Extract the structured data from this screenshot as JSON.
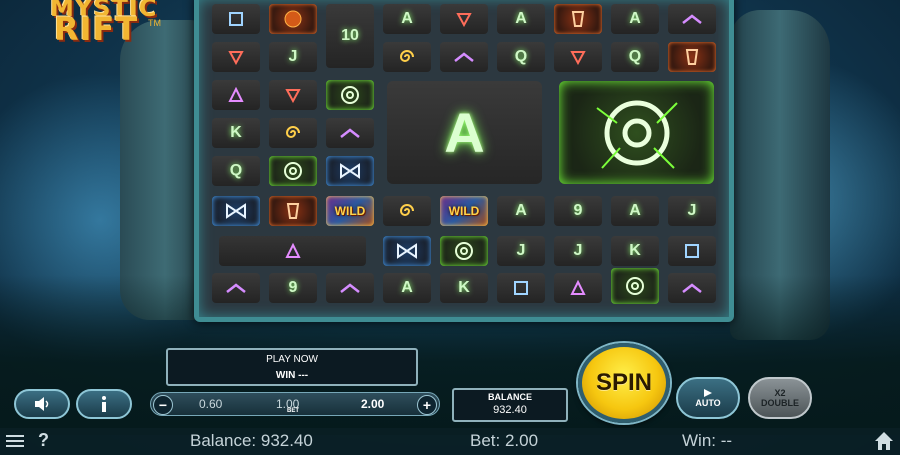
{
  "logo": {
    "line1": "MYSTIC",
    "line2": "RIFT",
    "tm": "TM"
  },
  "reels": {
    "labels": {
      "k": "K",
      "q": "Q",
      "j": "J",
      "a": "A",
      "nine": "9",
      "ten": "10",
      "wild": "WILD"
    },
    "big_symbol": "A"
  },
  "play_panel": {
    "status": "PLAY NOW",
    "win_label": "WIN ---"
  },
  "controls": {
    "sound_icon": "speaker-icon",
    "info_icon": "info-icon",
    "bet_minus": "−",
    "bet_plus": "+",
    "bet_values": [
      "0.60",
      "1.00",
      "2.00"
    ],
    "bet_selected": "2.00",
    "bet_label": "BET",
    "spin": "SPIN",
    "auto": "AUTO",
    "double_top": "X2",
    "double_bottom": "DOUBLE"
  },
  "balance_box": {
    "title": "BALANCE",
    "value": "932.40"
  },
  "status_bar": {
    "help": "?",
    "balance": "Balance: 932.40",
    "bet": "Bet: 2.00",
    "win": "Win: --"
  },
  "colors": {
    "spin": "#f6c710",
    "rune_glow": "#8cff70",
    "frame": "#3f8d93"
  }
}
